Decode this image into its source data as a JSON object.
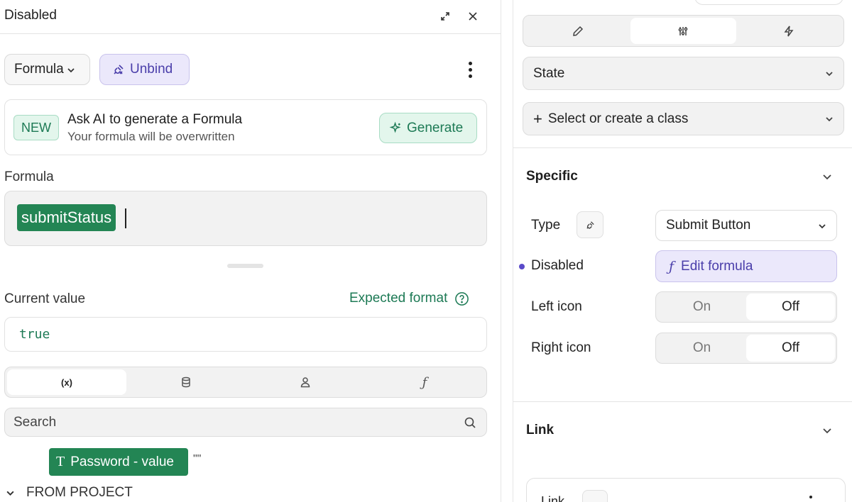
{
  "left_panel": {
    "title": "Disabled",
    "formula_dropdown_label": "Formula",
    "unbind_label": "Unbind",
    "ai_card": {
      "badge": "NEW",
      "title": "Ask AI to generate a Formula",
      "subtitle": "Your formula will be overwritten",
      "generate_label": "Generate"
    },
    "formula_label": "Formula",
    "formula_variable": "submitStatus",
    "current_value_label": "Current value",
    "expected_format_label": "Expected format",
    "current_value": "true",
    "tabs": [
      "(x)",
      "database-icon",
      "user-icon",
      "ƒ"
    ],
    "search_placeholder": "Search",
    "variable_item": {
      "type_glyph": "T",
      "label": "Password - value",
      "value": "\"\""
    },
    "from_project_label": "FROM PROJECT"
  },
  "right_panel": {
    "tabs": [
      "pencil-icon",
      "sliders-icon",
      "lightning-icon"
    ],
    "state_label": "State",
    "class_select_label": "Select or create a class",
    "specific_section": {
      "title": "Specific",
      "type_label": "Type",
      "type_value": "Submit Button",
      "disabled_label": "Disabled",
      "edit_formula_label": "Edit formula",
      "left_icon_label": "Left icon",
      "right_icon_label": "Right icon",
      "toggle_on": "On",
      "toggle_off": "Off",
      "left_icon_value": "Off",
      "right_icon_value": "Off"
    },
    "link_section": {
      "title": "Link",
      "link_label": "Link"
    }
  },
  "colors": {
    "accent_green": "#238554",
    "accent_purple": "#4a3eaa",
    "purple_bg": "#ebe8fb",
    "green_bg": "#e3f6ec"
  }
}
